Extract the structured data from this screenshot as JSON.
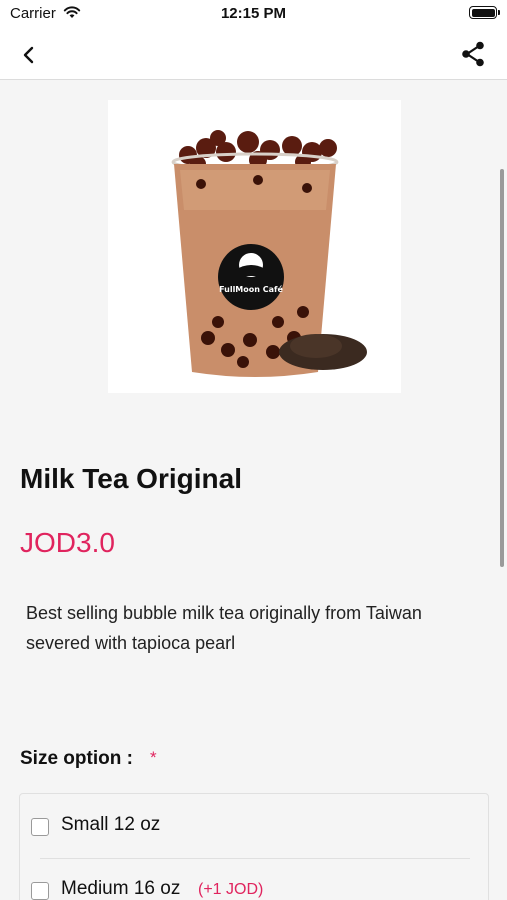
{
  "status_bar": {
    "carrier": "Carrier",
    "time": "12:15 PM"
  },
  "nav": {
    "back_icon": "chevron-left-icon",
    "share_icon": "share-icon"
  },
  "product": {
    "name": "Milk Tea Original",
    "price": "JOD3.0",
    "description": "Best selling bubble milk tea originally from Taiwan severed with tapioca pearl",
    "logo_text": "FullMoon Café"
  },
  "size_section": {
    "label": "Size option :",
    "required_mark": "*",
    "options": [
      {
        "label": "Small 12 oz",
        "extra": "",
        "checked": false
      },
      {
        "label": "Medium 16 oz",
        "extra": "(+1 JOD)",
        "checked": false
      }
    ]
  },
  "colors": {
    "accent": "#e0245e",
    "background": "#f5f5f5"
  }
}
